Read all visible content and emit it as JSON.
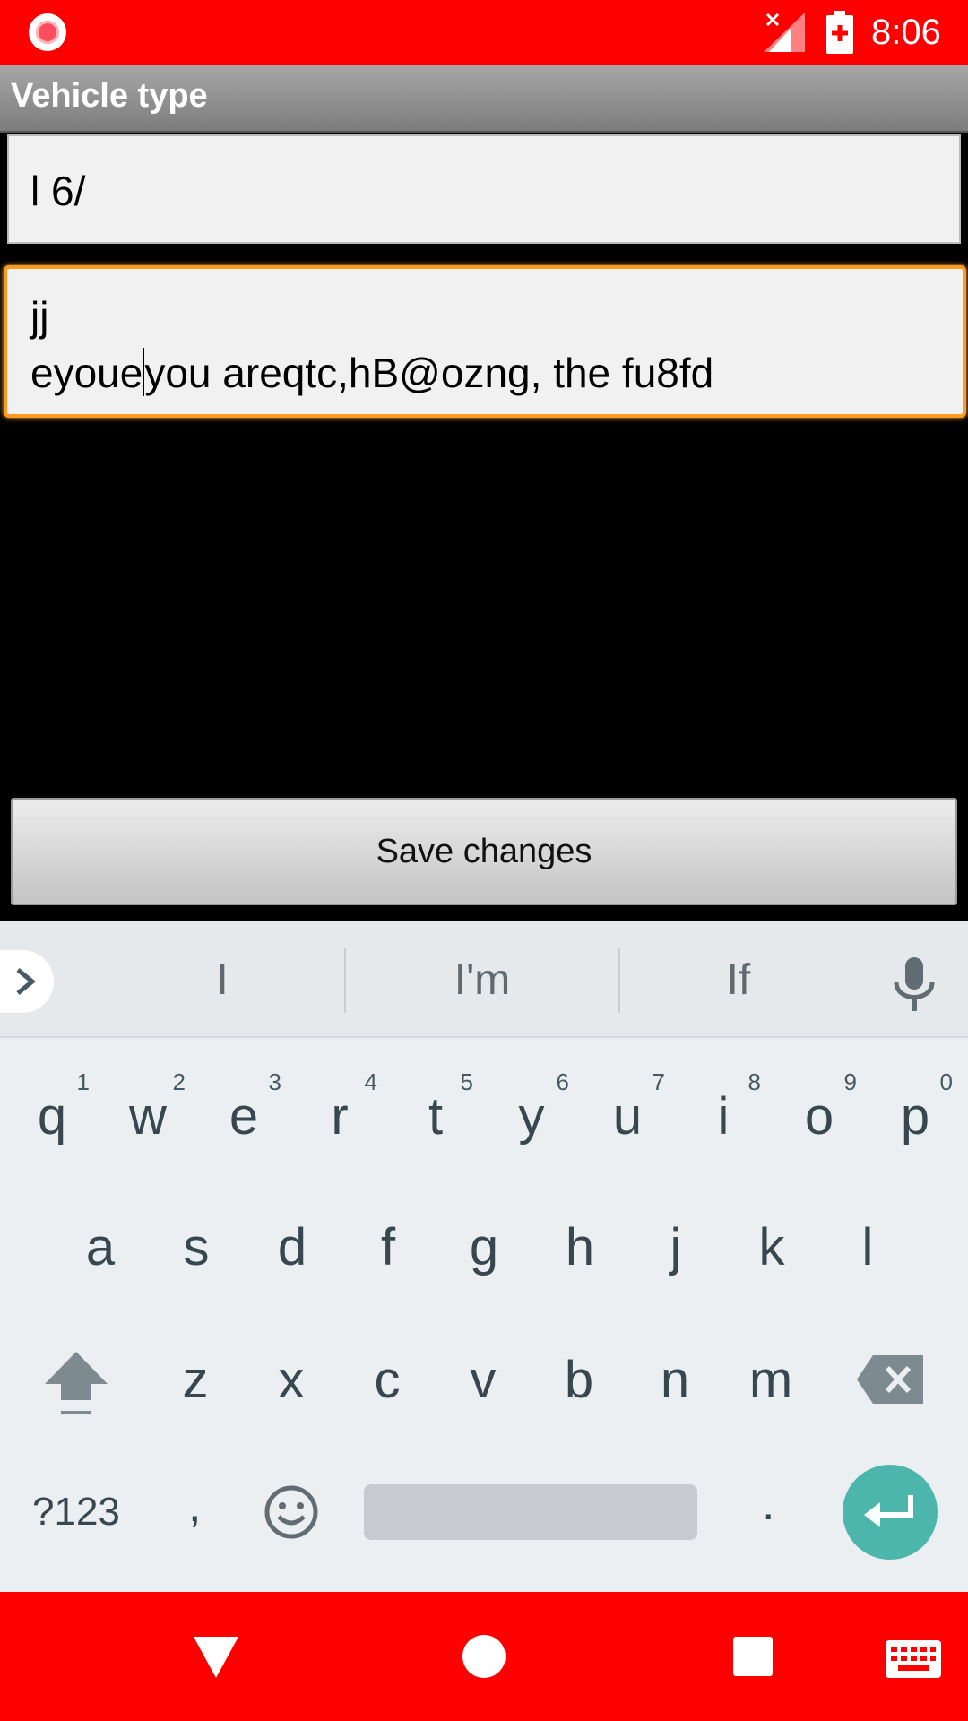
{
  "status_bar": {
    "time": "8:06"
  },
  "app": {
    "title": "Vehicle type",
    "field_1": {
      "value": "l 6/"
    },
    "field_2": {
      "line_1": "jj",
      "line_2_before_caret": "eyoue",
      "line_2_after_caret": "you areqtc,hB@ozng, the fu8fd"
    },
    "save_label": "Save changes"
  },
  "keyboard": {
    "suggestions": [
      "I",
      "I'm",
      "If"
    ],
    "row1": [
      {
        "key": "q",
        "num": "1"
      },
      {
        "key": "w",
        "num": "2"
      },
      {
        "key": "e",
        "num": "3"
      },
      {
        "key": "r",
        "num": "4"
      },
      {
        "key": "t",
        "num": "5"
      },
      {
        "key": "y",
        "num": "6"
      },
      {
        "key": "u",
        "num": "7"
      },
      {
        "key": "i",
        "num": "8"
      },
      {
        "key": "o",
        "num": "9"
      },
      {
        "key": "p",
        "num": "0"
      }
    ],
    "row2": [
      "a",
      "s",
      "d",
      "f",
      "g",
      "h",
      "j",
      "k",
      "l"
    ],
    "row3": [
      "z",
      "x",
      "c",
      "v",
      "b",
      "n",
      "m"
    ],
    "symbols_label": "?123",
    "comma_label": ",",
    "period_label": ".",
    "accent_color": "#4db6ac"
  },
  "colors": {
    "status_bar": "#ff0000",
    "focus_border": "#ff9a1e"
  }
}
